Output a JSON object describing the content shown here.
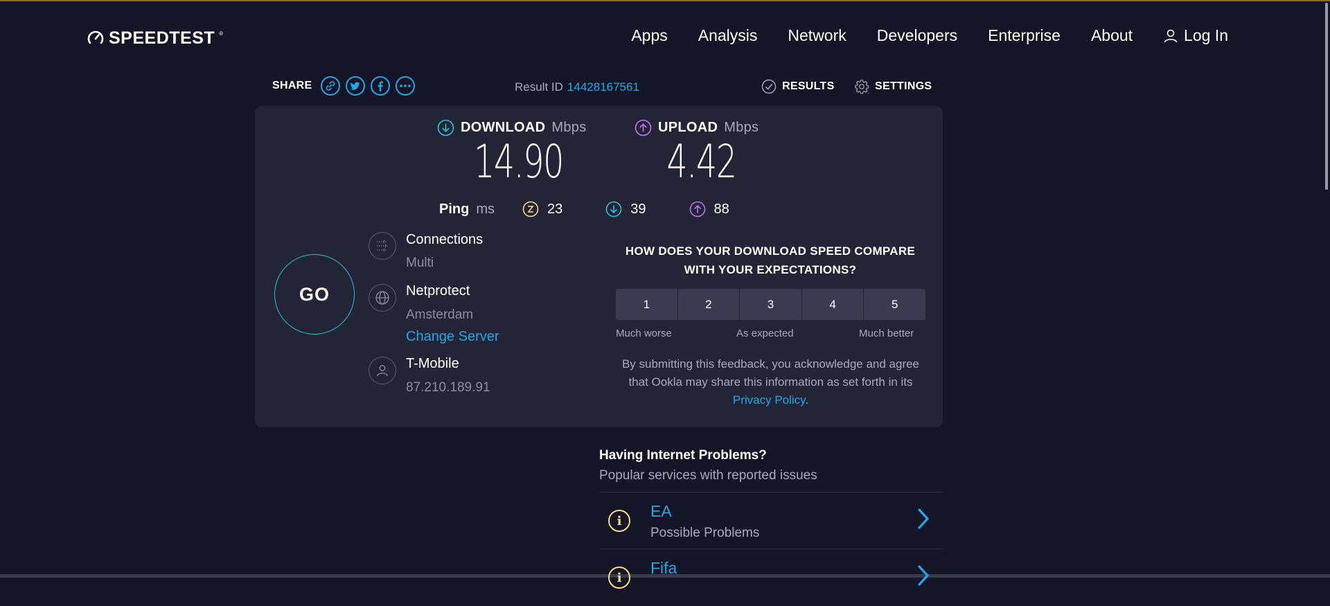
{
  "header": {
    "logo_text": "SPEEDTEST",
    "logo_tm": "®",
    "nav": [
      {
        "label": "Apps"
      },
      {
        "label": "Analysis"
      },
      {
        "label": "Network"
      },
      {
        "label": "Developers"
      },
      {
        "label": "Enterprise"
      },
      {
        "label": "About"
      }
    ],
    "login_label": "Log In"
  },
  "share": {
    "label": "SHARE",
    "icons": [
      "link-icon",
      "twitter-icon",
      "facebook-icon",
      "more-icon"
    ]
  },
  "result": {
    "label": "Result ID",
    "id": "14428167561"
  },
  "actions": {
    "results_label": "RESULTS",
    "settings_label": "SETTINGS"
  },
  "download": {
    "label": "DOWNLOAD",
    "unit": "Mbps",
    "value": "14.90",
    "color": "#25c5d6"
  },
  "upload": {
    "label": "UPLOAD",
    "unit": "Mbps",
    "value": "4.42",
    "color": "#bf71f5"
  },
  "ping": {
    "label": "Ping",
    "unit": "ms",
    "idle": "23",
    "download": "39",
    "upload": "88",
    "idle_color": "#f1e27a"
  },
  "go_label": "GO",
  "connections": {
    "title": "Connections",
    "value": "Multi"
  },
  "server": {
    "title": "Netprotect",
    "location": "Amsterdam",
    "change_label": "Change Server"
  },
  "isp": {
    "title": "T-Mobile",
    "ip": "87.210.189.91"
  },
  "feedback": {
    "question_line1": "HOW DOES YOUR DOWNLOAD SPEED COMPARE",
    "question_line2": "WITH YOUR EXPECTATIONS?",
    "options": [
      "1",
      "2",
      "3",
      "4",
      "5"
    ],
    "scale_low": "Much worse",
    "scale_mid": "As expected",
    "scale_high": "Much better",
    "disclaimer": "By submitting this feedback, you acknowledge and agree that Ookla may share this information as set forth in its",
    "privacy_link": "Privacy Policy",
    "period": "."
  },
  "problems": {
    "title": "Having Internet Problems?",
    "subtitle": "Popular services with reported issues",
    "items": [
      {
        "name": "EA",
        "status": "Possible Problems"
      },
      {
        "name": "Fifa",
        "status": ""
      }
    ]
  },
  "colors": {
    "accent": "#1ca9e8",
    "background": "#141526",
    "card": "#232436"
  }
}
